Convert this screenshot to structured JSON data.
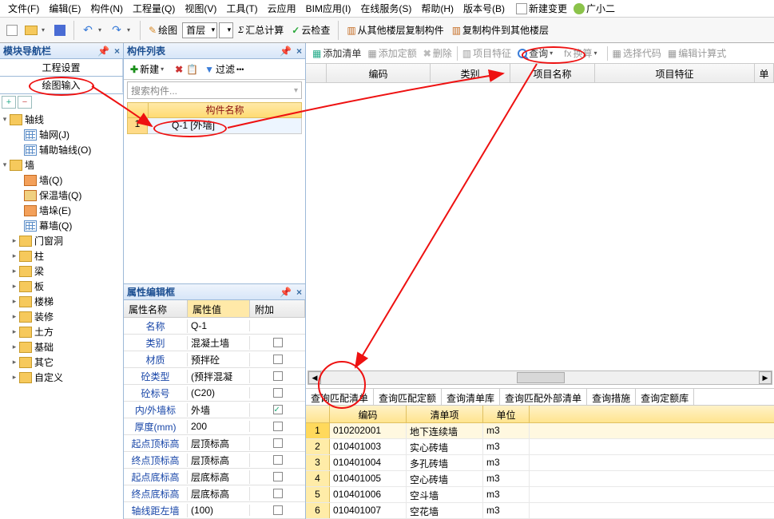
{
  "menu": {
    "items": [
      "文件(F)",
      "编辑(E)",
      "构件(N)",
      "工程量(Q)",
      "视图(V)",
      "工具(T)",
      "云应用",
      "BIM应用(I)",
      "在线服务(S)",
      "帮助(H)",
      "版本号(B)"
    ],
    "right": {
      "newchange": "新建变更",
      "user": "广小二"
    }
  },
  "toolbar": {
    "draw": "绘图",
    "floor": "首层",
    "sum": "汇总计算",
    "cloud": "云检查",
    "copyfrom": "从其他楼层复制构件",
    "copyto": "复制构件到其他楼层"
  },
  "left_panel": {
    "title": "模块导航栏",
    "tabs": {
      "proj": "工程设置",
      "draw": "绘图输入"
    },
    "plus": "+",
    "minus": "−",
    "tree": {
      "axis": "轴线",
      "axis_net": "轴网(J)",
      "axis_aux": "辅助轴线(O)",
      "wall": "墙",
      "wall_q": "墙(Q)",
      "wall_ins": "保温墙(Q)",
      "wall_duo": "墙垛(E)",
      "wall_curtain": "幕墙(Q)",
      "others": [
        "门窗洞",
        "柱",
        "梁",
        "板",
        "楼梯",
        "装修",
        "土方",
        "基础",
        "其它",
        "自定义"
      ]
    }
  },
  "mid_panel": {
    "title": "构件列表",
    "new": "新建",
    "filter": "过滤",
    "search_placeholder": "搜索构件...",
    "col_header": "构件名称",
    "rows": [
      {
        "idx": "1",
        "name": "Q-1 [外墙]"
      }
    ],
    "prop_title": "属性编辑框",
    "prop_headers": {
      "name": "属性名称",
      "value": "属性值",
      "extra": "附加"
    },
    "props": [
      {
        "n": "名称",
        "v": "Q-1",
        "c": null
      },
      {
        "n": "类别",
        "v": "混凝土墙",
        "c": false
      },
      {
        "n": "材质",
        "v": "预拌砼",
        "c": false
      },
      {
        "n": "砼类型",
        "v": "(预拌混凝",
        "c": false
      },
      {
        "n": "砼标号",
        "v": "(C20)",
        "c": false
      },
      {
        "n": "内/外墙标",
        "v": "外墙",
        "c": true
      },
      {
        "n": "厚度(mm)",
        "v": "200",
        "c": false
      },
      {
        "n": "起点顶标高",
        "v": "层顶标高",
        "c": false
      },
      {
        "n": "终点顶标高",
        "v": "层顶标高",
        "c": false
      },
      {
        "n": "起点底标高",
        "v": "层底标高",
        "c": false
      },
      {
        "n": "终点底标高",
        "v": "层底标高",
        "c": false
      },
      {
        "n": "轴线距左墙",
        "v": "(100)",
        "c": false
      }
    ]
  },
  "right_panel": {
    "toolbar": {
      "add_list": "添加清单",
      "add_quota": "添加定额",
      "delete": "删除",
      "proj_feat": "项目特征",
      "query": "查询",
      "convert": "换算",
      "select_code": "选择代码",
      "edit_formula": "编辑计算式"
    },
    "grid_headers": {
      "code": "编码",
      "cat": "类别",
      "name": "项目名称",
      "feat": "项目特征",
      "unit": "单"
    },
    "query_tabs": [
      "查询匹配清单",
      "查询匹配定额",
      "查询清单库",
      "查询匹配外部清单",
      "查询措施",
      "查询定额库"
    ],
    "query_headers": {
      "code": "编码",
      "item": "清单项",
      "unit": "单位"
    },
    "query_rows": [
      {
        "i": "1",
        "code": "010202001",
        "item": "地下连续墙",
        "unit": "m3"
      },
      {
        "i": "2",
        "code": "010401003",
        "item": "实心砖墙",
        "unit": "m3"
      },
      {
        "i": "3",
        "code": "010401004",
        "item": "多孔砖墙",
        "unit": "m3"
      },
      {
        "i": "4",
        "code": "010401005",
        "item": "空心砖墙",
        "unit": "m3"
      },
      {
        "i": "5",
        "code": "010401006",
        "item": "空斗墙",
        "unit": "m3"
      },
      {
        "i": "6",
        "code": "010401007",
        "item": "空花墙",
        "unit": "m3"
      }
    ]
  }
}
